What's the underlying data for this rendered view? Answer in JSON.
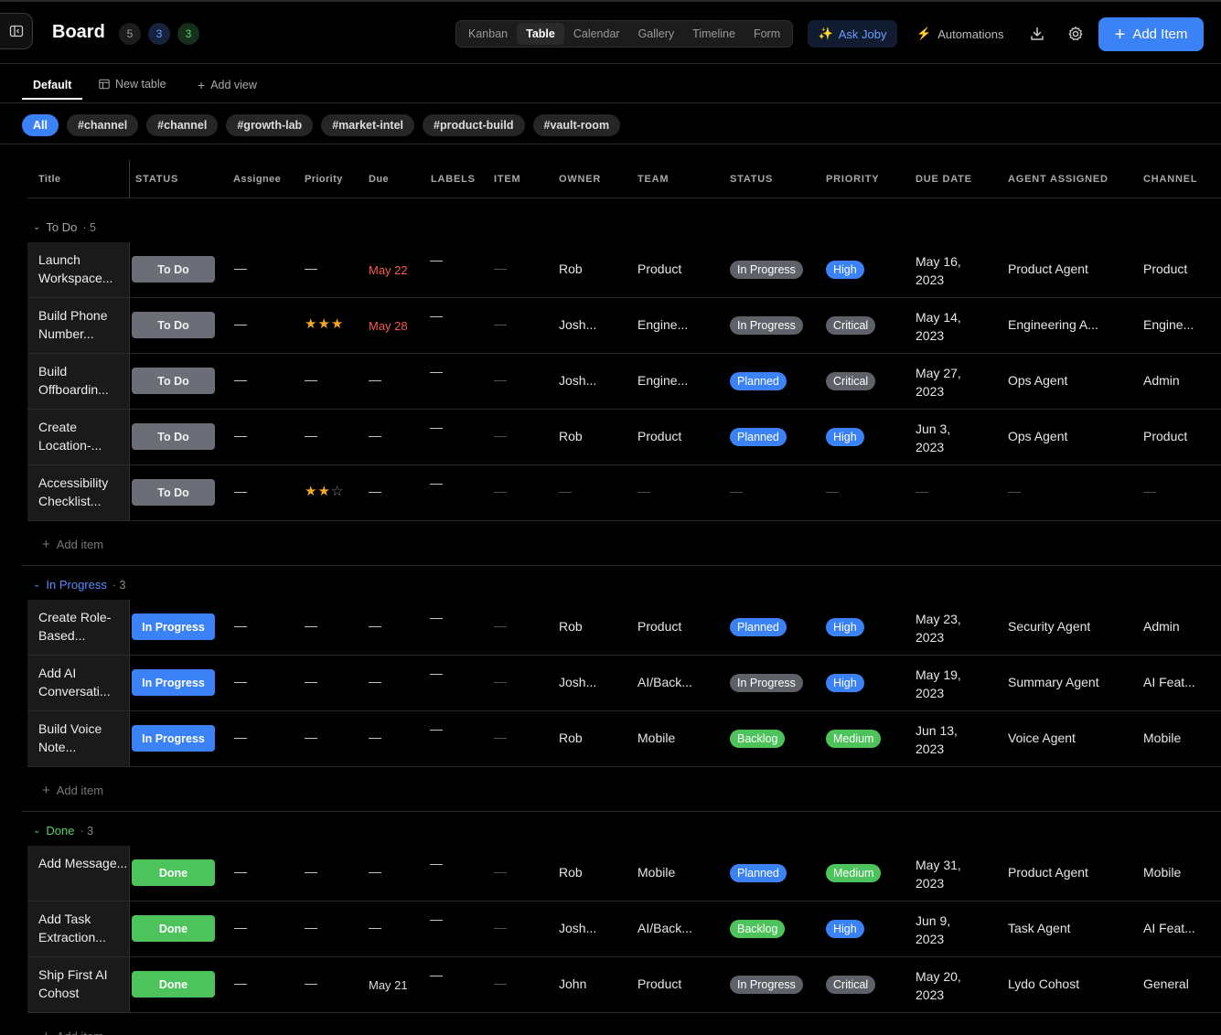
{
  "header": {
    "title": "Board",
    "counts": [
      "5",
      "3",
      "3"
    ],
    "views": [
      "Kanban",
      "Table",
      "Calendar",
      "Gallery",
      "Timeline",
      "Form"
    ],
    "active_view": "Table",
    "ask_label": "Ask Joby",
    "automations_label": "Automations",
    "add_item_label": "Add Item"
  },
  "tabs": {
    "default": "Default",
    "new_table": "New table",
    "add_view": "Add view"
  },
  "filters": [
    "All",
    "#channel",
    "#channel",
    "#growth-lab",
    "#market-intel",
    "#product-build",
    "#vault-room"
  ],
  "columns": [
    "Title",
    "STATUS",
    "Assignee",
    "Priority",
    "Due",
    "LABELS",
    "ITEM",
    "OWNER",
    "TEAM",
    "STATUS",
    "PRIORITY",
    "DUE DATE",
    "AGENT ASSIGNED",
    "CHANNEL"
  ],
  "groups": [
    {
      "name": "To Do",
      "count": "· 5",
      "color": "#a8a8a8",
      "rows": [
        {
          "title": "Launch Workspace...",
          "status": "To Do",
          "stars": 0,
          "due": "May 22",
          "owner": "Rob",
          "team": "Product",
          "status2": "In Progress",
          "priority": "High",
          "due_date": "May 16, 2023",
          "agent": "Product Agent",
          "channel": "Product"
        },
        {
          "title": "Build Phone Number...",
          "status": "To Do",
          "stars": 3,
          "due": "May 28",
          "owner": "Josh...",
          "team": "Engine...",
          "status2": "In Progress",
          "priority": "Critical",
          "due_date": "May 14, 2023",
          "agent": "Engineering A...",
          "channel": "Engine..."
        },
        {
          "title": "Build Offboardin...",
          "status": "To Do",
          "stars": 0,
          "due": "",
          "owner": "Josh...",
          "team": "Engine...",
          "status2": "Planned",
          "priority": "Critical",
          "due_date": "May 27, 2023",
          "agent": "Ops Agent",
          "channel": "Admin"
        },
        {
          "title": "Create Location-...",
          "status": "To Do",
          "stars": 0,
          "due": "",
          "owner": "Rob",
          "team": "Product",
          "status2": "Planned",
          "priority": "High",
          "due_date": "Jun 3, 2023",
          "agent": "Ops Agent",
          "channel": "Product"
        },
        {
          "title": "Accessibility Checklist...",
          "status": "To Do",
          "stars": 2,
          "due": "",
          "owner": "",
          "team": "",
          "status2": "",
          "priority": "",
          "due_date": "",
          "agent": "",
          "channel": ""
        }
      ]
    },
    {
      "name": "In Progress",
      "count": "· 3",
      "color": "#5b8cff",
      "rows": [
        {
          "title": "Create Role-Based...",
          "status": "In Progress",
          "stars": 0,
          "due": "",
          "owner": "Rob",
          "team": "Product",
          "status2": "Planned",
          "priority": "High",
          "due_date": "May 23, 2023",
          "agent": "Security Agent",
          "channel": "Admin"
        },
        {
          "title": "Add AI Conversati...",
          "status": "In Progress",
          "stars": 0,
          "due": "",
          "owner": "Josh...",
          "team": "AI/Back...",
          "status2": "In Progress",
          "priority": "High",
          "due_date": "May 19, 2023",
          "agent": "Summary Agent",
          "channel": "AI Feat..."
        },
        {
          "title": "Build Voice Note...",
          "status": "In Progress",
          "stars": 0,
          "due": "",
          "owner": "Rob",
          "team": "Mobile",
          "status2": "Backlog",
          "priority": "Medium",
          "due_date": "Jun 13, 2023",
          "agent": "Voice Agent",
          "channel": "Mobile"
        }
      ]
    },
    {
      "name": "Done",
      "count": "· 3",
      "color": "#57d36b",
      "rows": [
        {
          "title": "Add Message...",
          "status": "Done",
          "stars": 0,
          "due": "",
          "owner": "Rob",
          "team": "Mobile",
          "status2": "Planned",
          "priority": "Medium",
          "due_date": "May 31, 2023",
          "agent": "Product Agent",
          "channel": "Mobile"
        },
        {
          "title": "Add Task Extraction...",
          "status": "Done",
          "stars": 0,
          "due": "",
          "owner": "Josh...",
          "team": "AI/Back...",
          "status2": "Backlog",
          "priority": "High",
          "due_date": "Jun 9, 2023",
          "agent": "Task Agent",
          "channel": "AI Feat..."
        },
        {
          "title": "Ship First AI Cohost",
          "status": "Done",
          "stars": 0,
          "due": "May 21",
          "owner": "John",
          "team": "Product",
          "status2": "In Progress",
          "priority": "Critical",
          "due_date": "May 20, 2023",
          "agent": "Lydo Cohost",
          "channel": "General"
        }
      ]
    }
  ],
  "add_item_row_label": "Add item",
  "empty_value": "—"
}
